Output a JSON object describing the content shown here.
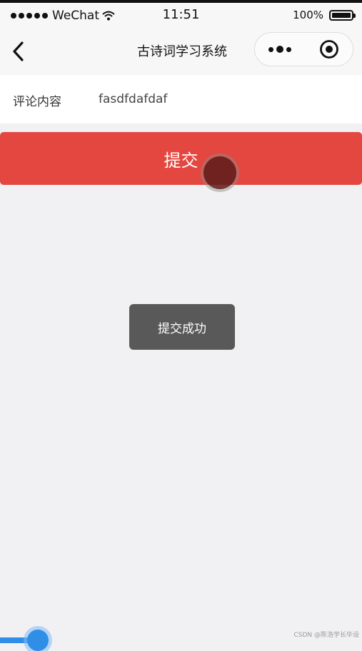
{
  "status_bar": {
    "carrier": "WeChat",
    "time": "11:51",
    "battery": "100%"
  },
  "nav": {
    "title": "古诗词学习系统"
  },
  "form": {
    "label": "评论内容",
    "value": "fasdfdafdaf"
  },
  "submit": {
    "label": "提交"
  },
  "toast": {
    "message": "提交成功"
  },
  "watermark": "CSDN @陈浩学长毕设",
  "colors": {
    "primary": "#e3473f",
    "background": "#f1f1f3",
    "toast_bg": "#4c4c4c",
    "indicator": "#2f8ee6"
  },
  "icons": {
    "back": "chevron-left-icon",
    "more": "more-dots-icon",
    "close": "target-circle-icon",
    "wifi": "wifi-icon",
    "signal": "signal-dots-icon",
    "battery": "battery-icon"
  }
}
